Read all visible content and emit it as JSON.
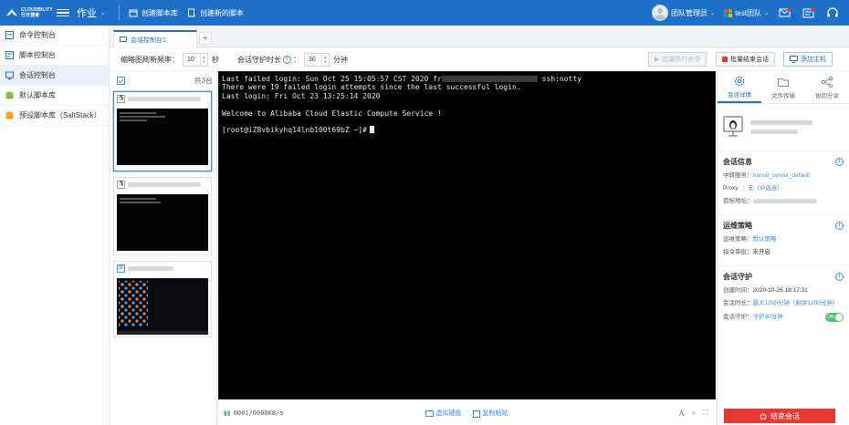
{
  "topbar": {
    "logo_text_1": "CLOUDBILITY",
    "logo_text_2": "行云管家",
    "menu_label": "作业",
    "action_create_lib": "创建脚本库",
    "action_create_script": "创建新的脚本",
    "user_label": "团队管理员",
    "team_label": "test团队"
  },
  "sidebar": {
    "items": [
      {
        "label": "命令控制台"
      },
      {
        "label": "脚本控制台"
      },
      {
        "label": "会话控制台"
      },
      {
        "label": "默认脚本库"
      },
      {
        "label": "预设脚本库（SaltStack）"
      }
    ]
  },
  "tabs": {
    "active_label": "会话控制台1",
    "add_label": "+"
  },
  "toolbar": {
    "refresh_label": "缩略图刷新频率：",
    "refresh_value": "10",
    "refresh_unit": "秒",
    "guard_label": "会话守护时长",
    "guard_value": "30",
    "guard_unit": "分钟",
    "batch_exec": "批量执行命令",
    "batch_end": "批量结束会话",
    "add_host": "添加主机"
  },
  "thumbs": {
    "total": "共3台"
  },
  "terminal": {
    "line1_a": "Last failed login: Sun Oct 25 15:05:57 CST 2020 fr",
    "line1_b": "ssh:notty",
    "line2": "There were 19 failed login attempts since the last successful login.",
    "line3": "Last login: Fri Oct 23 13:25:14 2020",
    "line4": "",
    "line5": "Welcome to Alibaba Cloud Elastic Compute Service !",
    "line6": "",
    "prompt": "[root@iZ8vbikyhq14lnb100t69bZ ~]#"
  },
  "statusbar": {
    "transfer": "0001/0000KB/s",
    "virtual_kb": "虚拟键盘",
    "copy_paste": "复制粘贴"
  },
  "right_panel": {
    "tabs": [
      {
        "label": "会话详情"
      },
      {
        "label": "文件传输"
      },
      {
        "label": "协同分享"
      }
    ],
    "session_info": {
      "title": "会话信息",
      "relay_k": "中转服务：",
      "relay_v": "transit_server_default",
      "proxy_k": "Proxy",
      "proxy_v": "：无（IP直连）",
      "target_k": "目标地址："
    },
    "ops_policy": {
      "title": "运维策略",
      "policy_k": "运维策略：",
      "policy_v": "默认策略",
      "approval_k": "指令审批：",
      "approval_v": "未开启"
    },
    "guard": {
      "title": "会话守护",
      "created_k": "创建时间：",
      "created_v": "2020-10-26 18:17:31",
      "duration_k": "会话时长：",
      "duration_v": "最大1200分钟（剩余1200分钟）",
      "guard_k": "会话守护：",
      "guard_v": "守护30分钟",
      "toggle": "ON"
    },
    "end_button": "结束会话"
  },
  "colors": {
    "brand": "#1e6fc7",
    "link": "#3c8ee6",
    "danger": "#e53935",
    "success": "#4cc06a"
  }
}
